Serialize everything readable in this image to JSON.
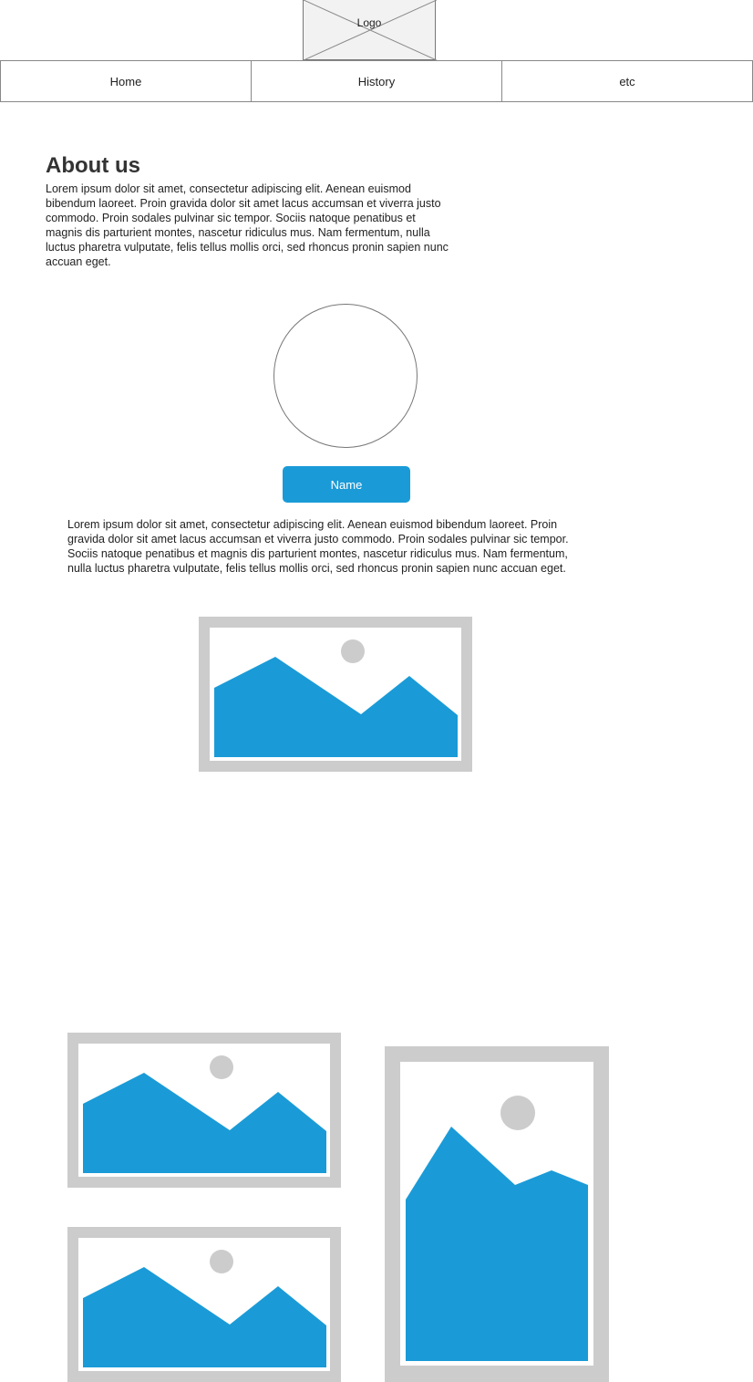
{
  "header": {
    "logo_label": "Logo"
  },
  "nav": {
    "items": [
      {
        "label": "Home"
      },
      {
        "label": "History"
      },
      {
        "label": "etc"
      }
    ]
  },
  "about": {
    "title": "About us",
    "text": "Lorem ipsum dolor sit amet, consectetur adipiscing elit. Aenean euismod bibendum laoreet. Proin gravida dolor sit amet lacus accumsan et viverra justo commodo. Proin sodales pulvinar sic tempor. Sociis natoque penatibus et magnis dis parturient montes, nascetur ridiculus mus. Nam fermentum, nulla luctus pharetra vulputate, felis tellus mollis orci, sed rhoncus pronin sapien nunc accuan eget."
  },
  "profile": {
    "name_button_label": "Name",
    "bio": "Lorem ipsum dolor sit amet, consectetur adipiscing elit. Aenean euismod bibendum laoreet. Proin gravida dolor sit amet lacus accumsan et viverra justo commodo. Proin sodales pulvinar sic tempor. Sociis natoque penatibus et magnis dis parturient montes, nascetur ridiculus mus. Nam fermentum, nulla luctus pharetra vulputate, felis tellus mollis orci, sed rhoncus pronin sapien nunc accuan eget."
  },
  "colors": {
    "accent": "#1a9bd7",
    "placeholder_frame": "#cccccc",
    "border": "#777777"
  },
  "icons": {
    "image_placeholder": "image-placeholder-icon",
    "logo_placeholder": "logo-placeholder-icon"
  }
}
